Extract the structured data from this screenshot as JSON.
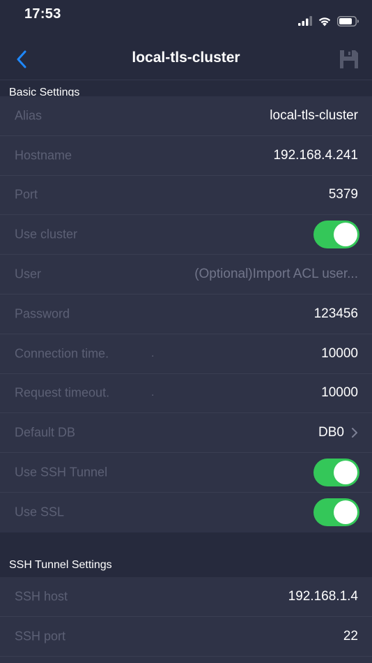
{
  "status_bar": {
    "time": "17:53",
    "icons": [
      "signal-icon",
      "wifi-icon",
      "battery-icon"
    ]
  },
  "nav": {
    "title": "local-tls-cluster",
    "back_icon": "chevron-left-icon",
    "save_icon": "save-icon"
  },
  "colors": {
    "background": "#262a3d",
    "row_background": "#2f3347",
    "accent": "#1e88ff",
    "toggle_on": "#34c759",
    "label": "#5c6075"
  },
  "basic_settings": {
    "header": "Basic Settings",
    "alias": {
      "label": "Alias",
      "value": "local-tls-cluster"
    },
    "hostname": {
      "label": "Hostname",
      "value": "192.168.4.241"
    },
    "port": {
      "label": "Port",
      "value": "5379"
    },
    "use_cluster": {
      "label": "Use cluster",
      "on": true
    },
    "user": {
      "label": "User",
      "placeholder": "(Optional)Import ACL user..."
    },
    "password": {
      "label": "Password",
      "value": "123456"
    },
    "connection_timeout": {
      "label": "Connection time.",
      "dot": ".",
      "value": "10000"
    },
    "request_timeout": {
      "label": "Request timeout.",
      "dot": ".",
      "value": "10000"
    },
    "default_db": {
      "label": "Default DB",
      "value": "DB0"
    },
    "use_ssh_tunnel": {
      "label": "Use SSH Tunnel",
      "on": true
    },
    "use_ssl": {
      "label": "Use SSL",
      "on": true
    }
  },
  "ssh_settings": {
    "header": "SSH Tunnel Settings",
    "ssh_host": {
      "label": "SSH host",
      "value": "192.168.1.4"
    },
    "ssh_port": {
      "label": "SSH port",
      "value": "22"
    }
  }
}
